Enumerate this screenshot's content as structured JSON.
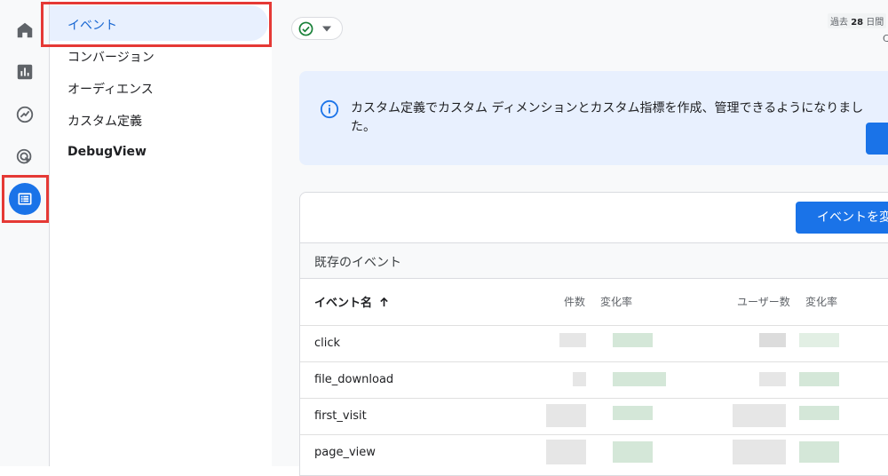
{
  "rail": {
    "icons": [
      "home-icon",
      "reports-icon",
      "explore-icon",
      "advertising-icon",
      "configure-icon"
    ],
    "active_color": "#1a73e8",
    "highlight_color": "#e53935"
  },
  "subnav": {
    "items": [
      {
        "label": "イベント",
        "active": true
      },
      {
        "label": "コンバージョン"
      },
      {
        "label": "オーディエンス"
      },
      {
        "label": "カスタム定義"
      },
      {
        "label": "DebugView"
      }
    ]
  },
  "header": {
    "status_icon": "check-circle-icon",
    "date_range_prefix": "過去",
    "date_range_days": "28",
    "date_range_suffix": "日間",
    "date_sub": "C"
  },
  "info_banner": {
    "icon": "info-icon",
    "text": "カスタム定義でカスタム ディメンションとカスタム指標を作成、管理できるようになりました。"
  },
  "events": {
    "create_button": "イベントを変",
    "section_title": "既存のイベント",
    "columns": {
      "name": "イベント名",
      "sort_icon": "arrow-up-icon",
      "count": "件数",
      "count_change": "変化率",
      "users": "ユーザー数",
      "users_change": "変化率"
    },
    "rows": [
      {
        "name": "click"
      },
      {
        "name": "file_download"
      },
      {
        "name": "first_visit"
      },
      {
        "name": "page_view"
      }
    ]
  }
}
